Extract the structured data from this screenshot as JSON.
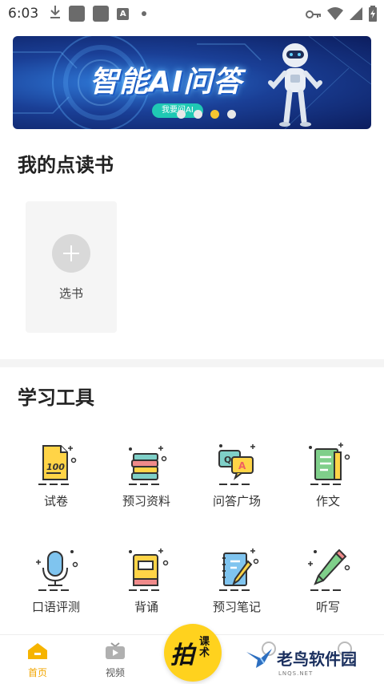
{
  "status_bar": {
    "time": "6:03",
    "icons": [
      "download-icon",
      "app-icon",
      "app-icon",
      "a-icon",
      "dot-icon",
      "key-icon",
      "wifi-icon",
      "signal-icon",
      "battery-icon"
    ]
  },
  "banner": {
    "title": "智能AI问答",
    "cta_label": "我要问AI",
    "active_dot_index": 2,
    "dot_count": 4
  },
  "my_books": {
    "title": "我的点读书",
    "add_label": "选书"
  },
  "tools": {
    "title": "学习工具",
    "items": [
      {
        "label": "试卷",
        "icon": "exam-paper-icon"
      },
      {
        "label": "预习资料",
        "icon": "book-stack-icon"
      },
      {
        "label": "问答广场",
        "icon": "qa-bubble-icon"
      },
      {
        "label": "作文",
        "icon": "composition-icon"
      },
      {
        "label": "口语评测",
        "icon": "microphone-icon"
      },
      {
        "label": "背诵",
        "icon": "recite-book-icon"
      },
      {
        "label": "预习笔记",
        "icon": "notebook-pencil-icon"
      },
      {
        "label": "听写",
        "icon": "pencil-icon"
      }
    ]
  },
  "bottom_nav": {
    "home_label": "首页",
    "video_label": "视频",
    "center_big": "拍",
    "center_small": "课术"
  },
  "watermark": {
    "text": "老鸟软件园",
    "sub": "LNQS.NET"
  },
  "colors": {
    "accent": "#f6c531",
    "nav_active": "#f2a600",
    "banner_dark": "#0c1d5e"
  }
}
